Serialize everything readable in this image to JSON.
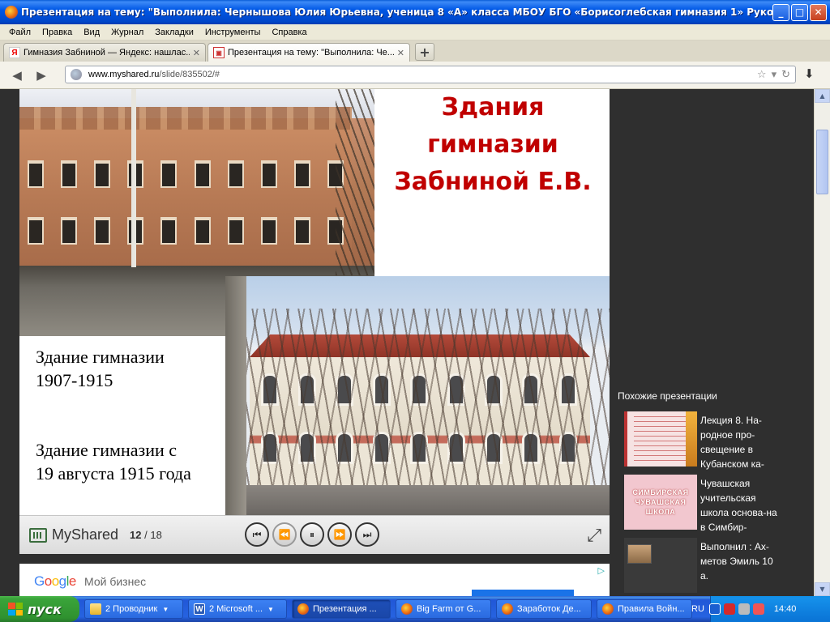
{
  "window": {
    "title": "Презентация на тему: \"Выполнила: Чернышова Юлия Юрьевна, ученица 8 «А» класса МБОУ БГО «Борисоглебская гимназия 1» Руководител..."
  },
  "menu": [
    "Файл",
    "Правка",
    "Вид",
    "Журнал",
    "Закладки",
    "Инструменты",
    "Справка"
  ],
  "tabs": [
    {
      "label": "Гимназия Забниной — Яндекс: нашлас...",
      "active": false
    },
    {
      "label": "Презентация на тему: \"Выполнила: Че...",
      "active": true
    }
  ],
  "url": {
    "host": "www.myshared.ru",
    "path": "/slide/835502/#"
  },
  "slide": {
    "title_line1": "Здания",
    "title_line2": "гимназии",
    "title_line3": "Забниной Е.В.",
    "caption1_line1": "Здание гимназии",
    "caption1_line2": "1907-1915",
    "caption2_line1": "Здание гимназии с",
    "caption2_line2": "19 августа 1915 года"
  },
  "player": {
    "logo": "MyShared",
    "current_page": "12",
    "page_separator": "/",
    "total_pages": "18"
  },
  "ad": {
    "google_letters": [
      "G",
      "o",
      "o",
      "g",
      "l",
      "e"
    ],
    "business": "Мой бизнес"
  },
  "sidebar": {
    "heading": "Похожие презентации",
    "items": [
      {
        "label": "Лекция 8. На-родное про-свещение в Кубанском ка-"
      },
      {
        "label": "Чувашская учительская школа основа-на в Симбир-",
        "thumb_text": "СИМБИРСКАЯ ЧУВАШСКАЯ ШКОЛА"
      },
      {
        "label": "Выполнил : Ах-метов Эмиль 10 а."
      }
    ]
  },
  "taskbar": {
    "start": "пуск",
    "tasks": [
      {
        "label": "2 Проводник",
        "icon": "folder-icon",
        "group": true
      },
      {
        "label": "2 Microsoft ...",
        "icon": "word-icon",
        "group": true
      },
      {
        "label": "Презентация ...",
        "icon": "firefox-icon",
        "active": true
      },
      {
        "label": "Big Farm от G...",
        "icon": "firefox-icon"
      },
      {
        "label": "Заработок Де...",
        "icon": "firefox-icon"
      },
      {
        "label": "Правила Войн...",
        "icon": "firefox-icon"
      }
    ],
    "lang": "RU",
    "clock": "14:40"
  }
}
